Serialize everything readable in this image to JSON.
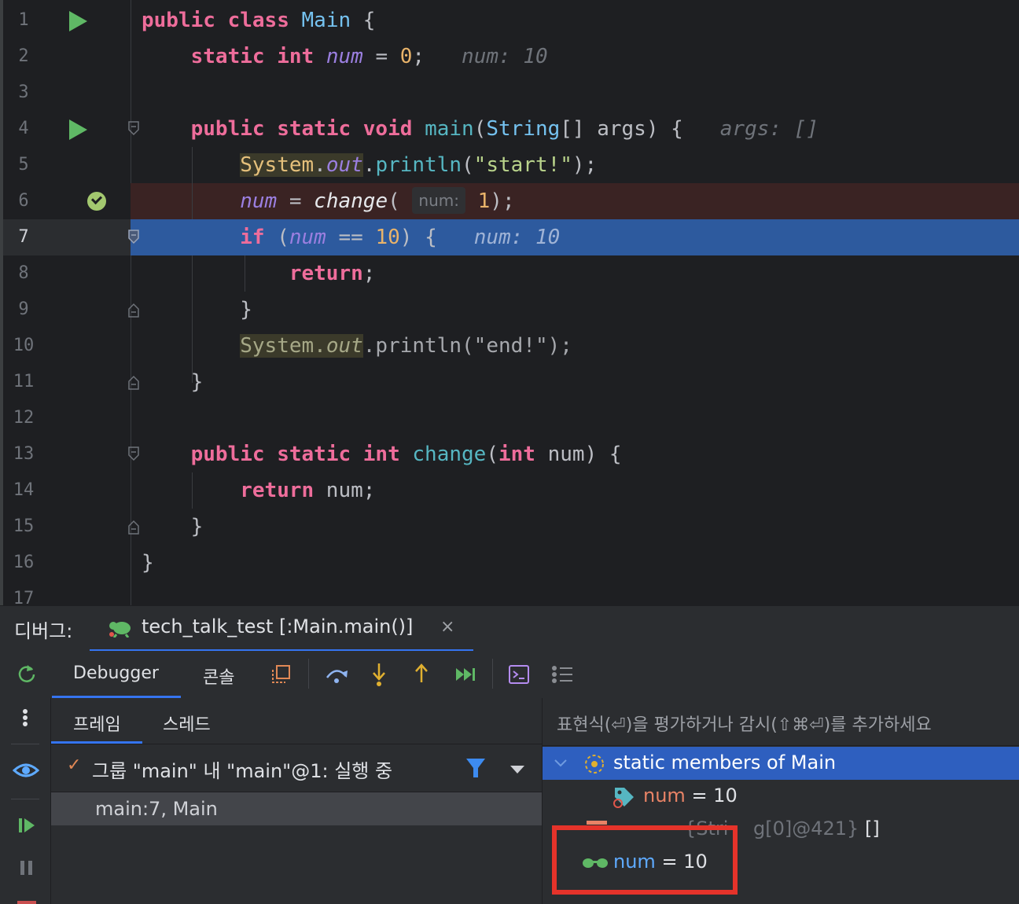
{
  "editor": {
    "lines": [
      {
        "n": "1"
      },
      {
        "n": "2"
      },
      {
        "n": "3"
      },
      {
        "n": "4"
      },
      {
        "n": "5"
      },
      {
        "n": "6"
      },
      {
        "n": "7"
      },
      {
        "n": "8"
      },
      {
        "n": "9"
      },
      {
        "n": "10"
      },
      {
        "n": "11"
      },
      {
        "n": "12"
      },
      {
        "n": "13"
      },
      {
        "n": "14"
      },
      {
        "n": "15"
      },
      {
        "n": "16"
      },
      {
        "n": "17"
      }
    ],
    "hints": {
      "l2": "num: 10",
      "l4": "args: []",
      "l6_param": "num:",
      "l7": "num: 10"
    }
  },
  "debug": {
    "title": "디버그:",
    "session_tab": "tech_talk_test [:Main.main()]",
    "close": "×",
    "tabs": {
      "debugger": "Debugger",
      "console": "콘솔"
    },
    "subtabs": {
      "frames": "프레임",
      "threads": "스레드"
    },
    "thread": "그룹 \"main\" 내 \"main\"@1: 실행 중",
    "frame": "main:7, Main",
    "eval_placeholder": "표현식(⏎)을 평가하거나 감시(⇧⌘⏎)를 추가하세요",
    "vars": {
      "static_members": "static members of Main",
      "num_name": "num",
      "num_eq": " = 10",
      "args_fragment": "{Stri",
      "args_fragment2": "g[0]@421}",
      "args_bracket": "[]",
      "watch_name": "num",
      "watch_eq": " = 10"
    }
  },
  "colors": {
    "highlight_box": "#e5332a",
    "selection": "#2e5fbf",
    "exec_line": "#2d5a9e"
  }
}
